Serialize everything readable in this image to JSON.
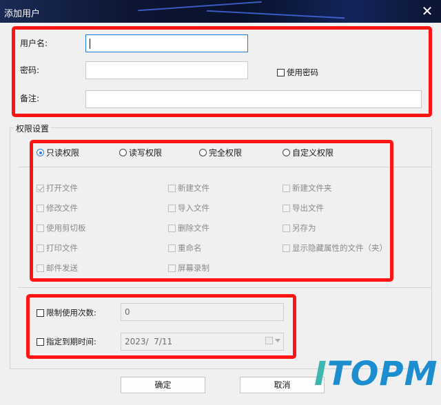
{
  "window": {
    "title": "添加用户"
  },
  "account": {
    "username_label": "用户名:",
    "username_value": "",
    "password_label": "密码:",
    "password_value": "",
    "use_password_label": "使用密码",
    "note_label": "备注:",
    "note_value": ""
  },
  "permissions": {
    "group_title": "权限设置",
    "radios": [
      "只读权限",
      "读写权限",
      "完全权限",
      "自定义权限"
    ],
    "selected": "只读权限",
    "checkboxes": {
      "open_file": "打开文件",
      "new_file": "新建文件",
      "new_folder": "新建文件夹",
      "modify_file": "修改文件",
      "import_file": "导入文件",
      "export_file": "导出文件",
      "clipboard": "使用剪切板",
      "delete_file": "删除文件",
      "save_as": "另存为",
      "print_file": "打印文件",
      "rename": "重命名",
      "show_hidden": "显示隐藏属性的文件（夹）",
      "mail": "邮件发送",
      "screen_record": "屏幕录制"
    }
  },
  "limits": {
    "limit_count_label": "限制使用次数:",
    "limit_count_value": "0",
    "expire_label": "指定到期时间:",
    "expire_value": "2023/  7/11"
  },
  "buttons": {
    "ok": "确定",
    "cancel": "取消"
  },
  "watermark": {
    "first": "I",
    "rest": "TOPM"
  },
  "colors": {
    "highlight": "#ff1414",
    "focus": "#1e7bd6",
    "radio_accent": "#2a7be0"
  }
}
